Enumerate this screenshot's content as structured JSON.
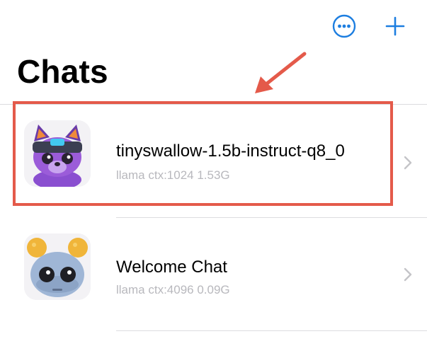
{
  "header": {
    "title": "Chats",
    "more_icon": "ellipsis-circle-icon",
    "add_icon": "plus-icon"
  },
  "chats": [
    {
      "name": "tinyswallow-1.5b-instruct-q8_0",
      "meta": "llama ctx:1024 1.53G",
      "avatar_icon": "fox-robot-avatar",
      "highlighted": true
    },
    {
      "name": "Welcome Chat",
      "meta": "llama ctx:4096 0.09G",
      "avatar_icon": "knit-robot-avatar",
      "highlighted": false
    }
  ],
  "colors": {
    "accent": "#1d7ee0",
    "annotation": "#e45a4a",
    "meta_text": "#b8b8bd"
  }
}
